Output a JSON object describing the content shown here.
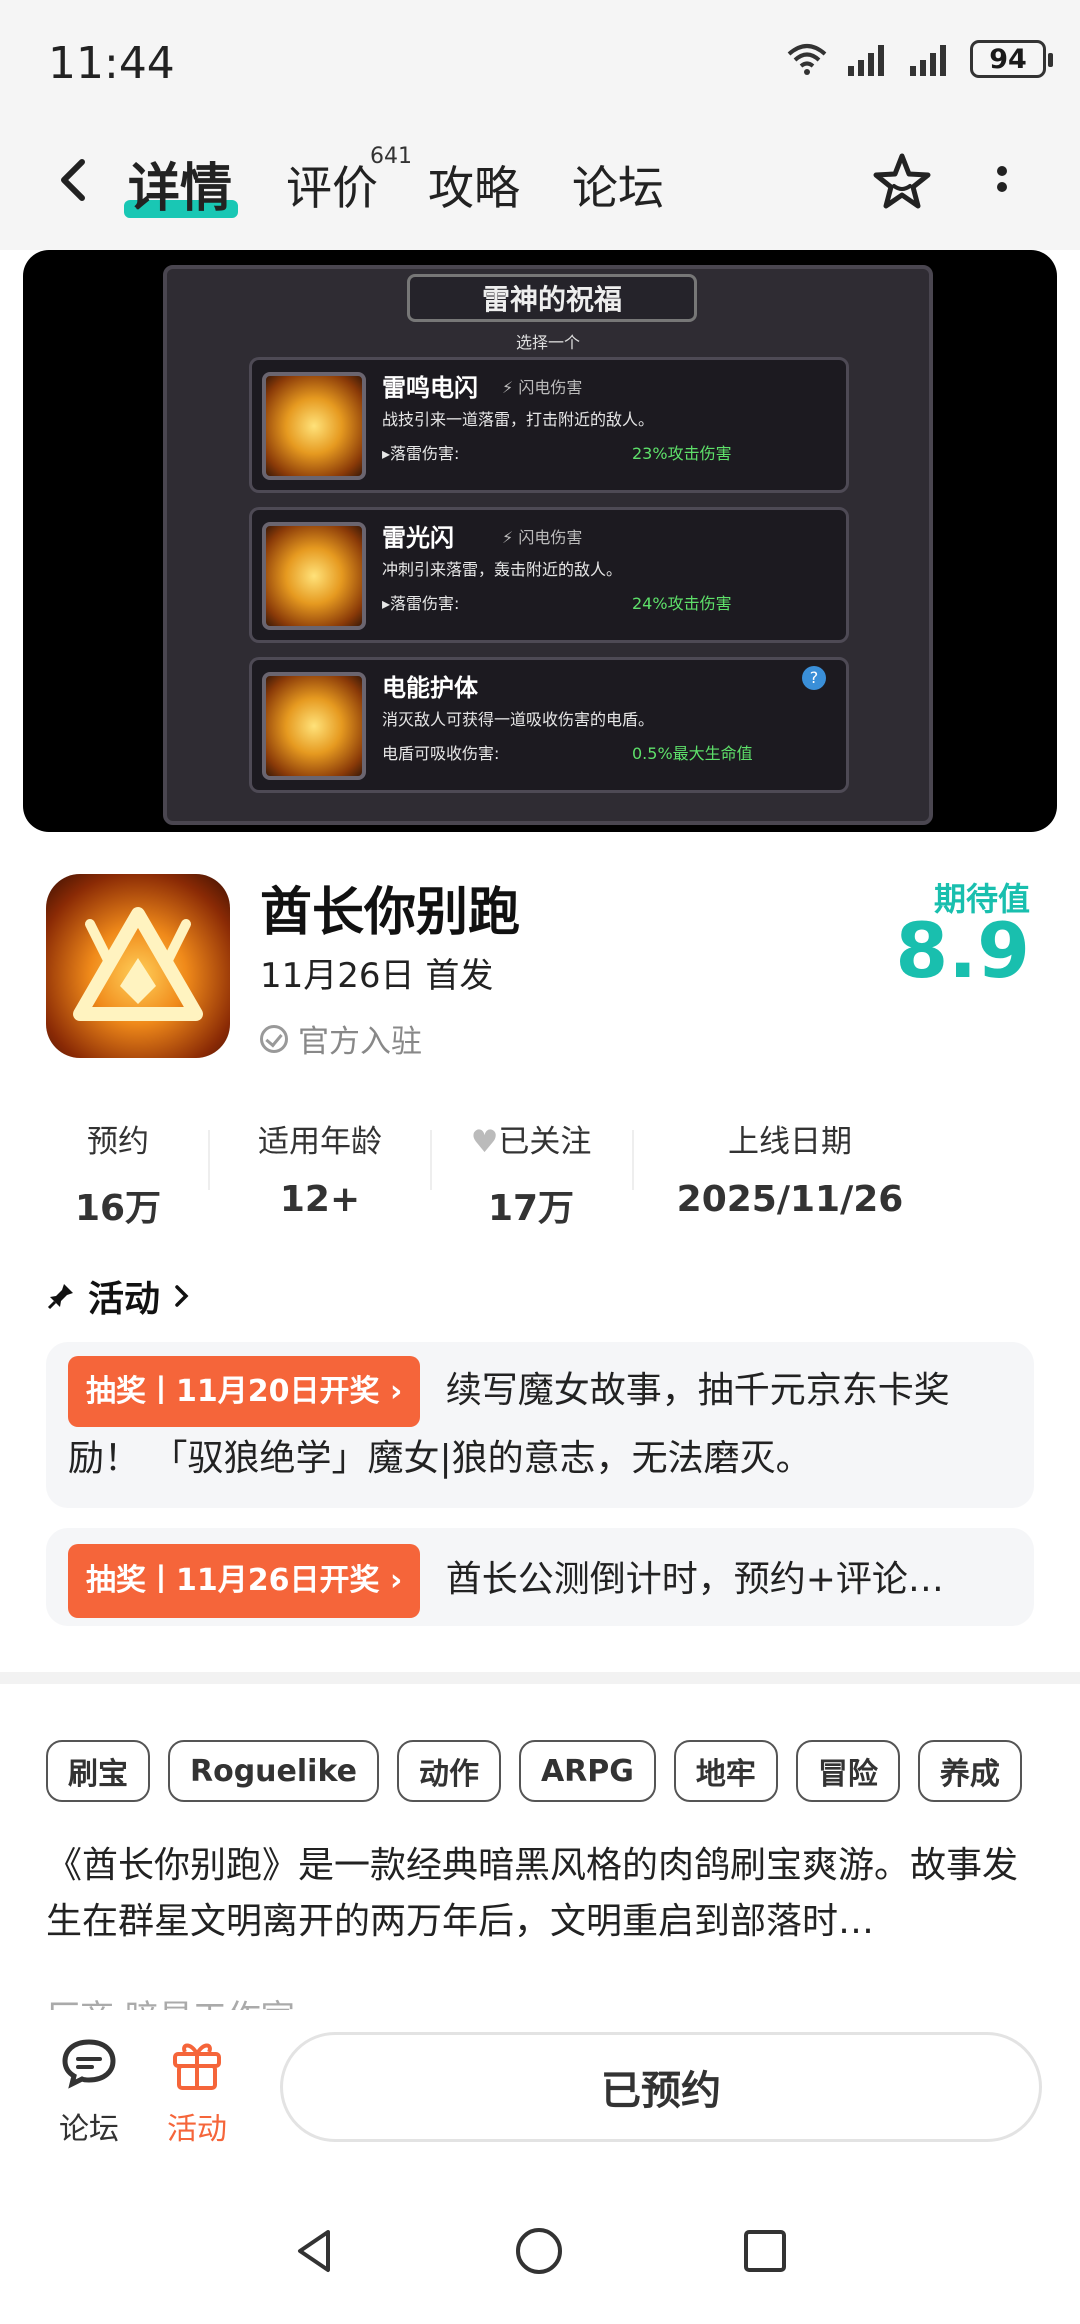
{
  "status_bar": {
    "time": "11:44",
    "battery": "94"
  },
  "header": {
    "tabs": [
      {
        "label": "详情",
        "active": true
      },
      {
        "label": "评价",
        "badge": "641"
      },
      {
        "label": "攻略"
      },
      {
        "label": "论坛"
      }
    ]
  },
  "banner": {
    "title": "雷神的祝福",
    "subtitle": "选择一个",
    "cards": [
      {
        "name": "雷鸣电闪",
        "type": "闪电伤害",
        "desc": "战技引来一道落雷，打击附近的敌人。",
        "stat_label": "▸落雷伤害:",
        "stat_value": "23%攻击伤害"
      },
      {
        "name": "雷光闪",
        "type": "闪电伤害",
        "desc": "冲刺引来落雷，轰击附近的敌人。",
        "stat_label": "▸落雷伤害:",
        "stat_value": "24%攻击伤害"
      },
      {
        "name": "电能护体",
        "type": "",
        "desc": "消灭敌人可获得一道吸收伤害的电盾。",
        "stat_label": "电盾可吸收伤害:",
        "stat_value": "0.5%最大生命值",
        "help": "?"
      }
    ]
  },
  "app": {
    "name": "酋长你别跑",
    "release": "11月26日 首发",
    "official": "官方入驻",
    "expect_label": "期待值",
    "expect_score": "8.9"
  },
  "stats": [
    {
      "label": "预约",
      "value": "16万"
    },
    {
      "label": "适用年龄",
      "value": "12+"
    },
    {
      "label": "已关注",
      "value": "17万"
    },
    {
      "label": "上线日期",
      "value": "2025/11/26"
    }
  ],
  "activities": {
    "heading": "活动",
    "items": [
      {
        "badge": "抽奖丨11月20日开奖",
        "text": "续写魔女故事，抽千元京东卡奖励！ 「驭狼绝学」魔女|狼的意志，无法磨灭。"
      },
      {
        "badge": "抽奖丨11月26日开奖",
        "text": "酋长公测倒计时，预约+评论…"
      }
    ]
  },
  "tags": [
    "刷宝",
    "Roguelike",
    "动作",
    "ARPG",
    "地牢",
    "冒险",
    "养成"
  ],
  "description": "《酋长你别跑》是一款经典暗黑风格的肉鸽刷宝爽游。故事发生在群星文明离开的两万年后，文明重启到部落时…",
  "description_next": "厂商  暗星工作室",
  "bottom_bar": {
    "forum_label": "论坛",
    "activity_label": "活动",
    "reserve_label": "已预约"
  },
  "colors": {
    "accent": "#19c7b4",
    "activity_badge": "#f5653a",
    "activity_tab": "#f5653a"
  }
}
